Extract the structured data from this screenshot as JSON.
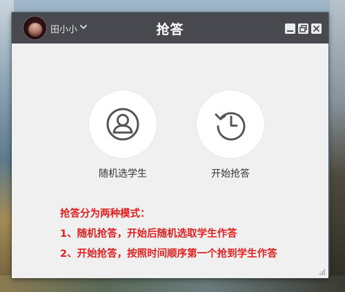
{
  "window": {
    "title": "抢答",
    "user": {
      "name": "田小小"
    },
    "controls": {
      "minimize": "minimize",
      "restore": "restore",
      "close": "close"
    }
  },
  "modes": [
    {
      "label": "随机选学生",
      "icon": "user-icon"
    },
    {
      "label": "开始抢答",
      "icon": "clock-history-icon"
    }
  ],
  "notes": {
    "heading": "抢答分为两种模式：",
    "lines": [
      "1、随机抢答，开始后随机选取学生作答",
      "2、开始抢答，按照时间顺序第一个抢到学生作答"
    ]
  },
  "colors": {
    "titlebar": "#47494e",
    "window_bg": "#f0f0f0",
    "note_text": "#e02020",
    "icon": "#555555"
  }
}
